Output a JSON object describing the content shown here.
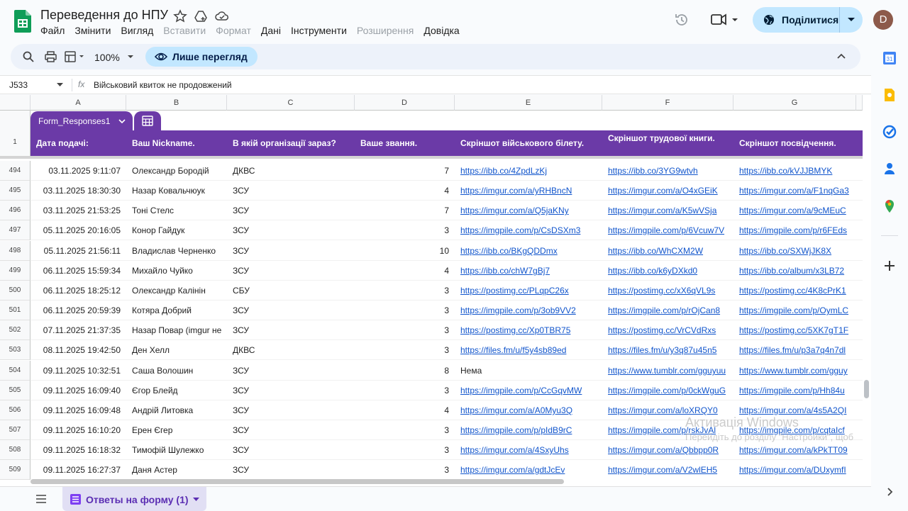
{
  "header": {
    "title": "Переведення до НПУ",
    "menu": [
      {
        "label": "Файл",
        "disabled": false
      },
      {
        "label": "Змінити",
        "disabled": false
      },
      {
        "label": "Вигляд",
        "disabled": false
      },
      {
        "label": "Вставити",
        "disabled": true
      },
      {
        "label": "Формат",
        "disabled": true
      },
      {
        "label": "Дані",
        "disabled": false
      },
      {
        "label": "Інструменти",
        "disabled": false
      },
      {
        "label": "Розширення",
        "disabled": true
      },
      {
        "label": "Довідка",
        "disabled": false
      }
    ],
    "share_label": "Поділитися",
    "avatar_letter": "D"
  },
  "toolbar": {
    "zoom": "100%",
    "view_only_label": "Лише перегляд"
  },
  "formula_bar": {
    "cell_ref": "J533",
    "fx": "fx",
    "content": "Військовий квиток не продовжений"
  },
  "grid": {
    "column_letters": [
      "A",
      "B",
      "C",
      "D",
      "E",
      "F",
      "G"
    ],
    "table_name": "Form_Responses1",
    "header_row_number": "1",
    "headers": [
      "Дата подачі:",
      "Ваш Nickname.",
      "В якій організації зараз?",
      "Ваше звання.",
      "Скріншот військового білету.",
      "Скріншот трудової книги.",
      "Скріншот посвідчення."
    ],
    "rows": [
      {
        "num": "494",
        "date": "03.11.2025 9:11:07",
        "nick": "Олександр Бородій",
        "org": "ДКВС",
        "rank": "7",
        "e": "https://ibb.co/4ZpdLzKj",
        "f": "https://ibb.co/3YG9wtvh",
        "g": "https://ibb.co/kVJJBMYK"
      },
      {
        "num": "495",
        "date": "03.11.2025 18:30:30",
        "nick": "Назар Ковальчюук",
        "org": "ЗСУ",
        "rank": "4",
        "e": "https://imgur.com/a/yRHBncN",
        "f": "https://imgur.com/a/O4xGEiK",
        "g": "https://imgur.com/a/F1nqGa3"
      },
      {
        "num": "496",
        "date": "03.11.2025 21:53:25",
        "nick": "Тоні Стелс",
        "org": "ЗСУ",
        "rank": "7",
        "e": "https://imgur.com/a/Q5jaKNy",
        "f": "https://imgur.com/a/K5wVSja",
        "g": "https://imgur.com/a/9cMEuC"
      },
      {
        "num": "497",
        "date": "05.11.2025 20:16:05",
        "nick": "Конор Гайдук",
        "org": "ЗСУ",
        "rank": "3",
        "e": "https://imgpile.com/p/CsDSXm3",
        "f": "https://imgpile.com/p/6Vcuw7V",
        "g": "https://imgpile.com/p/r6FEds"
      },
      {
        "num": "498",
        "date": "05.11.2025 21:56:11",
        "nick": "Владислав Черненко",
        "org": "ЗСУ",
        "rank": "10",
        "e": "https://ibb.co/BKgQDDmx",
        "f": "https://ibb.co/WhCXM2W",
        "g": "https://ibb.co/SXWjJK8X"
      },
      {
        "num": "499",
        "date": "06.11.2025 15:59:34",
        "nick": "Михайло Чуйко",
        "org": "ЗСУ",
        "rank": "4",
        "e": "https://ibb.co/chW7gBj7",
        "f": "https://ibb.co/k6yDXkd0",
        "g": "https://ibb.co/album/x3LB72"
      },
      {
        "num": "500",
        "date": "06.11.2025 18:25:12",
        "nick": "Олександр Калінін",
        "org": "СБУ",
        "rank": "3",
        "e": "https://postimg.cc/PLqpC26x",
        "f": "https://postimg.cc/xX6qVL9s",
        "g": "https://postimg.cc/4K8cPrK1"
      },
      {
        "num": "501",
        "date": "06.11.2025 20:59:39",
        "nick": "Котяра Добрий",
        "org": "ЗСУ",
        "rank": "3",
        "e": "https://imgpile.com/p/3ob9VV2",
        "f": "https://imgpile.com/p/rOjCan8",
        "g": "https://imgpile.com/p/OymLC"
      },
      {
        "num": "502",
        "date": "07.11.2025 21:37:35",
        "nick": "Назар Повар (imgur не",
        "org": "ЗСУ",
        "rank": "3",
        "e": "https://postimg.cc/Xp0TBR75",
        "f": "https://postimg.cc/VrCVdRxs",
        "g": "https://postimg.cc/5XK7gT1F"
      },
      {
        "num": "503",
        "date": "08.11.2025 19:42:50",
        "nick": "Ден Хелл",
        "org": "ДКВС",
        "rank": "3",
        "e": "https://files.fm/u/f5y4sb89ed",
        "f": "https://files.fm/u/y3q87u45n5",
        "g": "https://files.fm/u/p3a7q4n7dl"
      },
      {
        "num": "504",
        "date": "09.11.2025 10:32:51",
        "nick": "Саша Волошин",
        "org": "ЗСУ",
        "rank": "8",
        "e": "Нема",
        "f": "https://www.tumblr.com/gguyuu",
        "g": "https://www.tumblr.com/gguy"
      },
      {
        "num": "505",
        "date": "09.11.2025 16:09:40",
        "nick": "Єгор Блейд",
        "org": "ЗСУ",
        "rank": "3",
        "e": "https://imgpile.com/p/CcGqvMW",
        "f": "https://imgpile.com/p/0ckWguG",
        "g": "https://imgpile.com/p/Hh84u"
      },
      {
        "num": "506",
        "date": "09.11.2025 16:09:48",
        "nick": "Андрій Литовка",
        "org": "ЗСУ",
        "rank": "4",
        "e": "https://imgur.com/a/A0Myu3Q",
        "f": "https://imgur.com/a/loXRQY0",
        "g": "https://imgur.com/a/4s5A2QI"
      },
      {
        "num": "507",
        "date": "09.11.2025 16:10:20",
        "nick": "Ерен Єгер",
        "org": "ЗСУ",
        "rank": "3",
        "e": "https://imgpile.com/p/pIdB9rC",
        "f": "https://imgpile.com/p/rskJvAl",
        "g": "https://imgpile.com/p/cqtaIcf"
      },
      {
        "num": "508",
        "date": "09.11.2025 16:18:32",
        "nick": "Тимофій Шулежко",
        "org": "ЗСУ",
        "rank": "3",
        "e": "https://imgur.com/a/4SxyUhs",
        "f": "https://imgur.com/a/Qbbpp0R",
        "g": "https://imgur.com/a/kPkTT09"
      },
      {
        "num": "509",
        "date": "09.11.2025 16:27:37",
        "nick": "Даня Астер",
        "org": "ЗСУ",
        "rank": "3",
        "e": "https://imgur.com/a/gdtJcEv",
        "f": "https://imgur.com/a/V2wlEH5",
        "g": "https://imgur.com/a/DUxymfI"
      }
    ]
  },
  "sheet_tab": {
    "label": "Ответы на форму (1)"
  },
  "watermark": {
    "line1": "Активація Windows",
    "line2": "Перейдіть до розділу \"Настройки\", щоб"
  },
  "colors": {
    "accent_purple": "#6b3aa7",
    "share_blue": "#c2e7ff",
    "link": "#1155cc"
  }
}
